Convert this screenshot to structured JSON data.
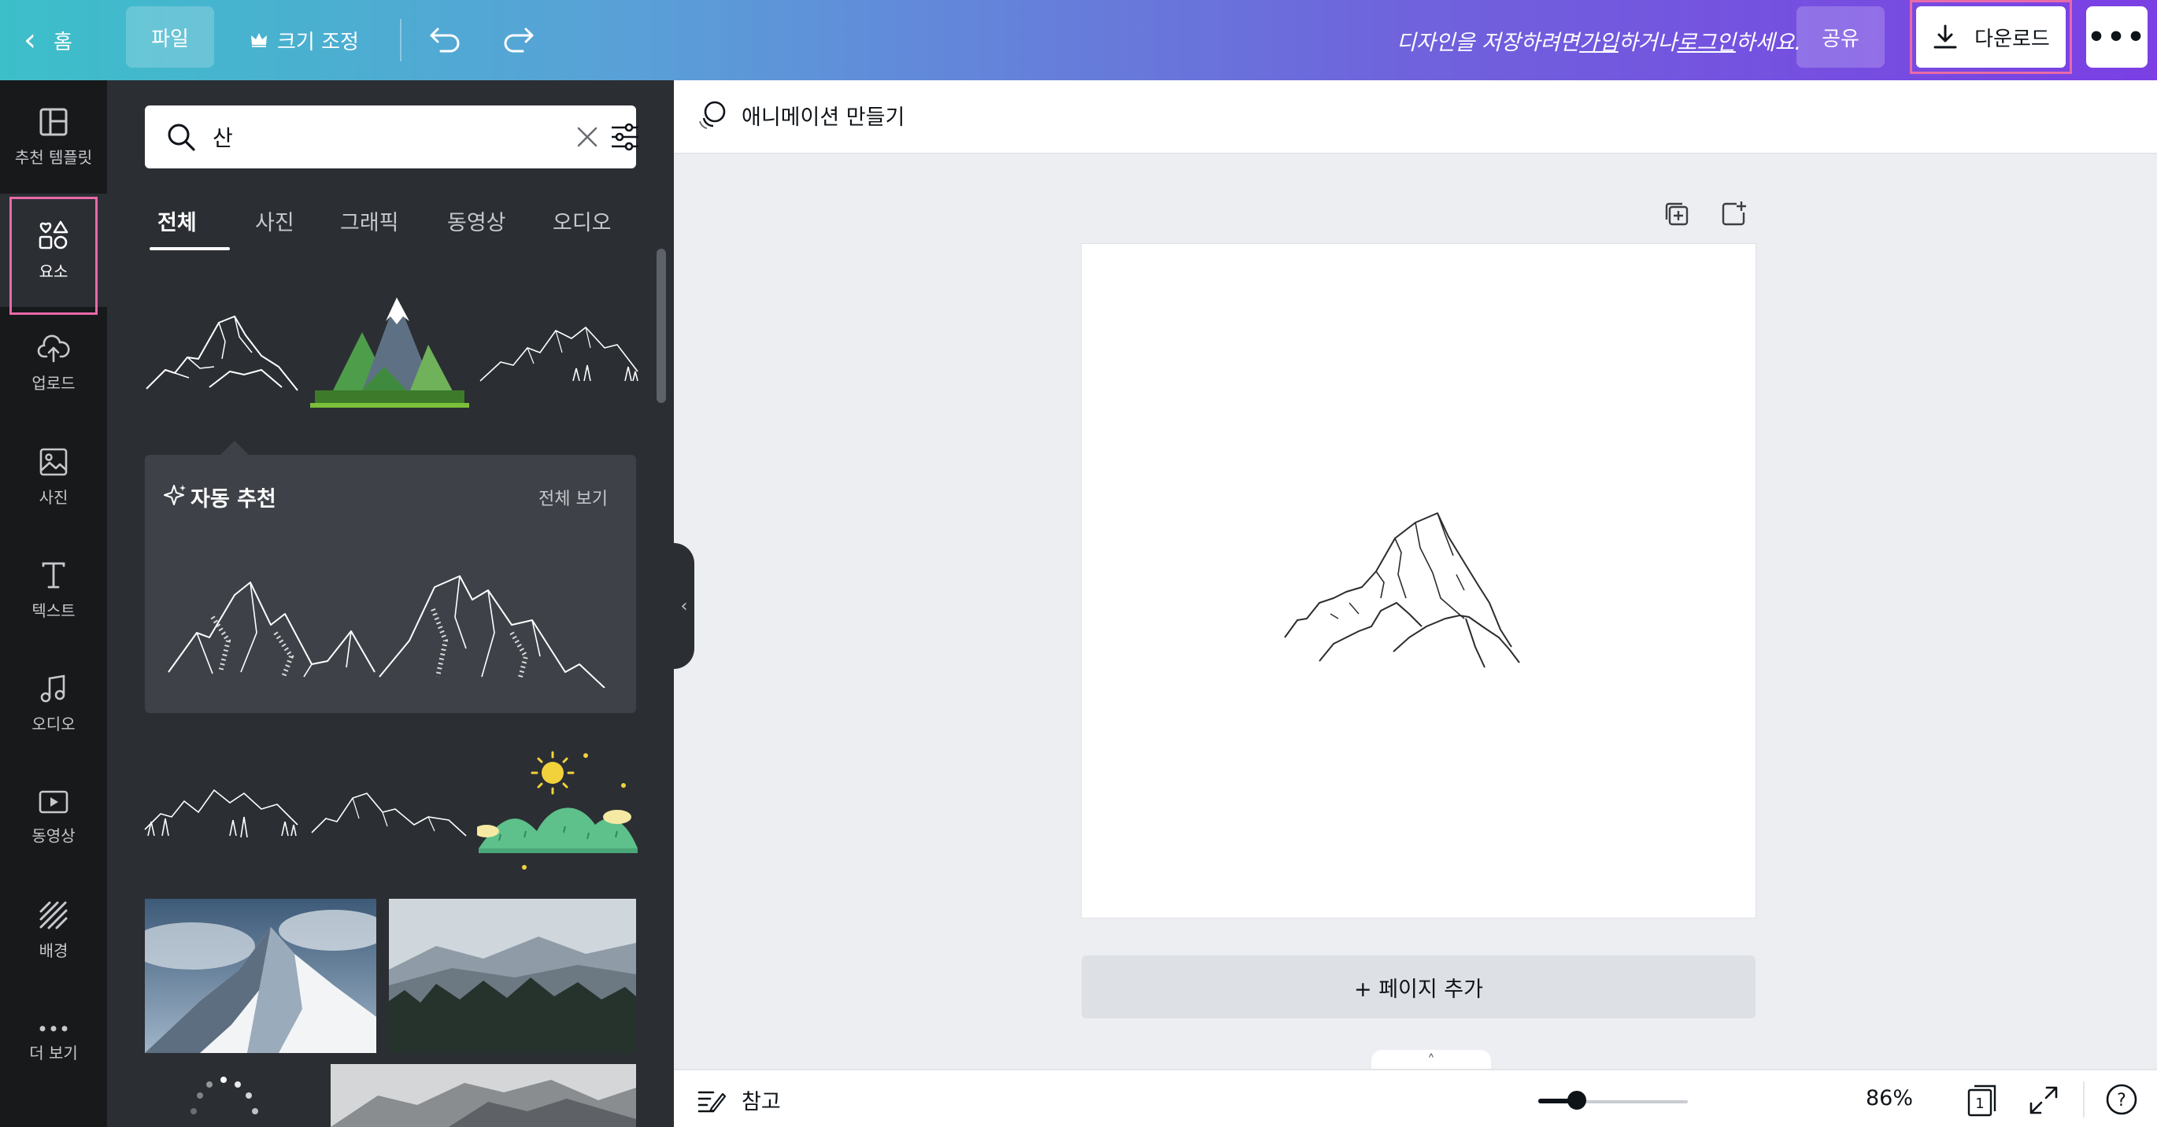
{
  "topbar": {
    "home_label": "홈",
    "file_label": "파일",
    "resize_label": "크기 조정",
    "message": {
      "prefix": "디자인을 저장하려면 ",
      "signup": "가입",
      "middle": "하거나 ",
      "login": "로그인",
      "suffix": "하세요."
    },
    "share_label": "공유",
    "download_label": "다운로드",
    "more_label": "•••"
  },
  "rail": {
    "items": [
      {
        "label": "추천 템플릿",
        "icon": "template-icon"
      },
      {
        "label": "요소",
        "icon": "elements-icon"
      },
      {
        "label": "업로드",
        "icon": "cloud-upload-icon"
      },
      {
        "label": "사진",
        "icon": "photo-icon"
      },
      {
        "label": "텍스트",
        "icon": "text-icon"
      },
      {
        "label": "오디오",
        "icon": "music-note-icon"
      },
      {
        "label": "동영상",
        "icon": "video-icon"
      },
      {
        "label": "배경",
        "icon": "background-pattern-icon"
      },
      {
        "label": "더 보기",
        "icon": "more-dots-icon"
      }
    ],
    "active": "요소"
  },
  "panel": {
    "search_value": "산",
    "tabs": [
      "전체",
      "사진",
      "그래픽",
      "동영상",
      "오디오"
    ],
    "active_tab": "전체",
    "recommend": {
      "title": "자동 추천",
      "see_all": "전체 보기"
    }
  },
  "editor": {
    "animate_label": "애니메이션 만들기",
    "add_page_label": "+ 페이지 추가"
  },
  "bottombar": {
    "notes_label": "참고",
    "zoom_value": "86%",
    "zoom_fraction": 0.26,
    "page_count": "1",
    "help_label": "?"
  },
  "colors": {
    "gradient_start": "#3cbfc9",
    "gradient_end": "#7b3fe4",
    "highlight": "#e86aa8",
    "panel_bg": "#2b2e33",
    "rail_bg": "#18191b"
  }
}
